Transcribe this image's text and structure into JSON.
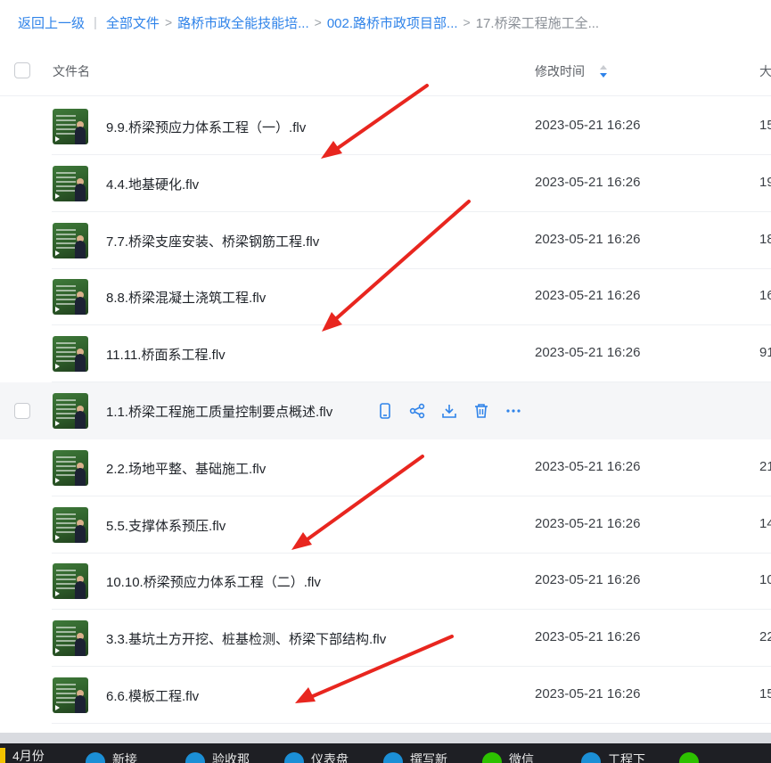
{
  "breadcrumb": {
    "back": "返回上一级",
    "sep": "|",
    "items": [
      "全部文件",
      "路桥市政全能技能培...",
      "002.路桥市政项目部...",
      "17.桥梁工程施工全..."
    ],
    "arrow": ">"
  },
  "header": {
    "name": "文件名",
    "time": "修改时间",
    "size": "大"
  },
  "files": [
    {
      "name": "9.9.桥梁预应力体系工程（一）.flv",
      "time": "2023-05-21 16:26",
      "size": "15"
    },
    {
      "name": "4.4.地基硬化.flv",
      "time": "2023-05-21 16:26",
      "size": "19"
    },
    {
      "name": "7.7.桥梁支座安装、桥梁钢筋工程.flv",
      "time": "2023-05-21 16:26",
      "size": "18"
    },
    {
      "name": "8.8.桥梁混凝土浇筑工程.flv",
      "time": "2023-05-21 16:26",
      "size": "16"
    },
    {
      "name": "11.11.桥面系工程.flv",
      "time": "2023-05-21 16:26",
      "size": "91"
    },
    {
      "name": "1.1.桥梁工程施工质量控制要点概述.flv",
      "time": "",
      "size": ""
    },
    {
      "name": "2.2.场地平整、基础施工.flv",
      "time": "2023-05-21 16:26",
      "size": "21"
    },
    {
      "name": "5.5.支撑体系预压.flv",
      "time": "2023-05-21 16:26",
      "size": "14"
    },
    {
      "name": "10.10.桥梁预应力体系工程（二）.flv",
      "time": "2023-05-21 16:26",
      "size": "10"
    },
    {
      "name": "3.3.基坑土方开挖、桩基检测、桥梁下部结构.flv",
      "time": "2023-05-21 16:26",
      "size": "22"
    },
    {
      "name": "6.6.模板工程.flv",
      "time": "2023-05-21 16:26",
      "size": "15"
    }
  ],
  "hover_actions": [
    "mobile-icon",
    "share-icon",
    "download-icon",
    "delete-icon",
    "more-icon"
  ],
  "taskbar": [
    "4月份",
    "新接",
    "验收那",
    "仪表盘",
    "撰写新",
    "微信",
    "工程下",
    ""
  ],
  "colors": {
    "accent": "#2f83e9",
    "arrow": "#e8261f",
    "hover_row": "#f5f6f8"
  }
}
